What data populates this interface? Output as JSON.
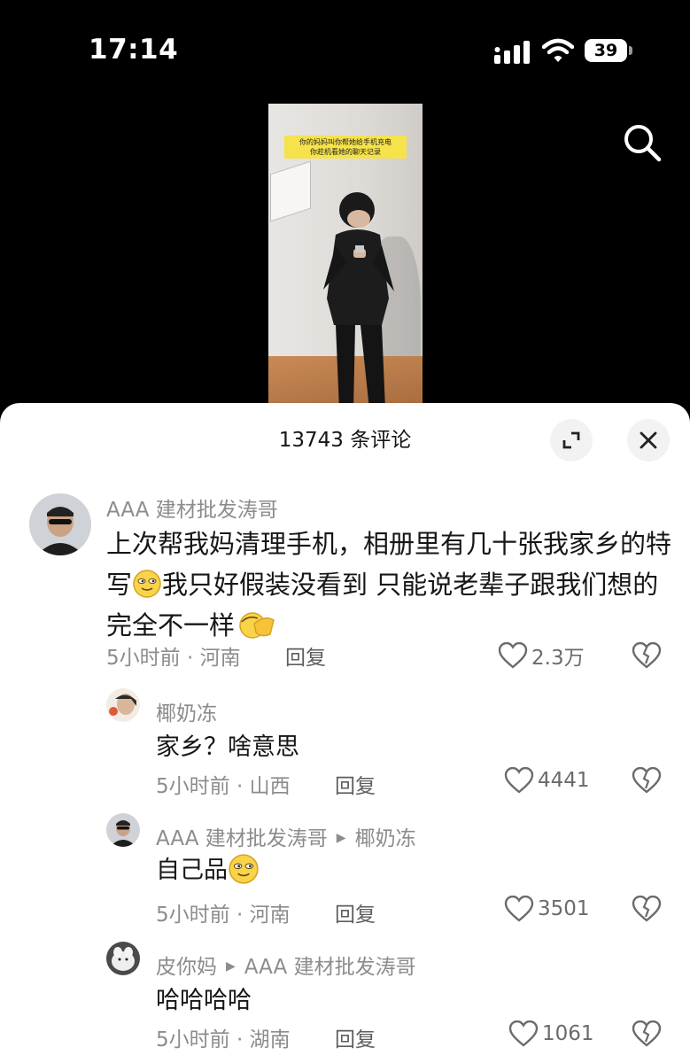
{
  "status_bar": {
    "time": "17:14",
    "battery": "39"
  },
  "video": {
    "caption_line1": "你的妈妈叫你帮她给手机充电",
    "caption_line2": "你趁机看她的聊天记录"
  },
  "comments_sheet": {
    "title": "13743 条评论",
    "comments": [
      {
        "user": "AAA 建材批发涛哥",
        "text_part1": "上次帮我妈清理手机，相册里有几十张我家乡的特写",
        "text_part2": "我只好假装没看到  只能说老辈子跟我们想的完全不一样",
        "time_location": "5小时前 · 河南",
        "reply_label": "回复",
        "likes": "2.3万"
      }
    ],
    "replies": [
      {
        "user": "椰奶冻",
        "reply_to": "",
        "text": "家乡？啥意思",
        "time_location": "5小时前 · 山西",
        "reply_label": "回复",
        "likes": "4441"
      },
      {
        "user": "AAA 建材批发涛哥",
        "reply_to": "椰奶冻",
        "text": "自己品",
        "time_location": "5小时前 · 河南",
        "reply_label": "回复",
        "likes": "3501"
      },
      {
        "user": "皮你妈",
        "reply_to": "AAA 建材批发涛哥",
        "text": "哈哈哈哈",
        "time_location": "5小时前 · 湖南",
        "reply_label": "回复",
        "likes": "1061"
      }
    ]
  },
  "icons": {
    "search": "search-icon",
    "expand": "expand-icon",
    "close": "close-icon",
    "like": "heart-icon",
    "dislike": "broken-heart-icon",
    "emoji_smirk": "smirk-emoji-icon",
    "emoji_cover": "cover-face-emoji-icon"
  },
  "colors": {
    "sheet_bg": "#ffffff",
    "muted_text": "#8c8c8c",
    "body_text": "#161616"
  }
}
